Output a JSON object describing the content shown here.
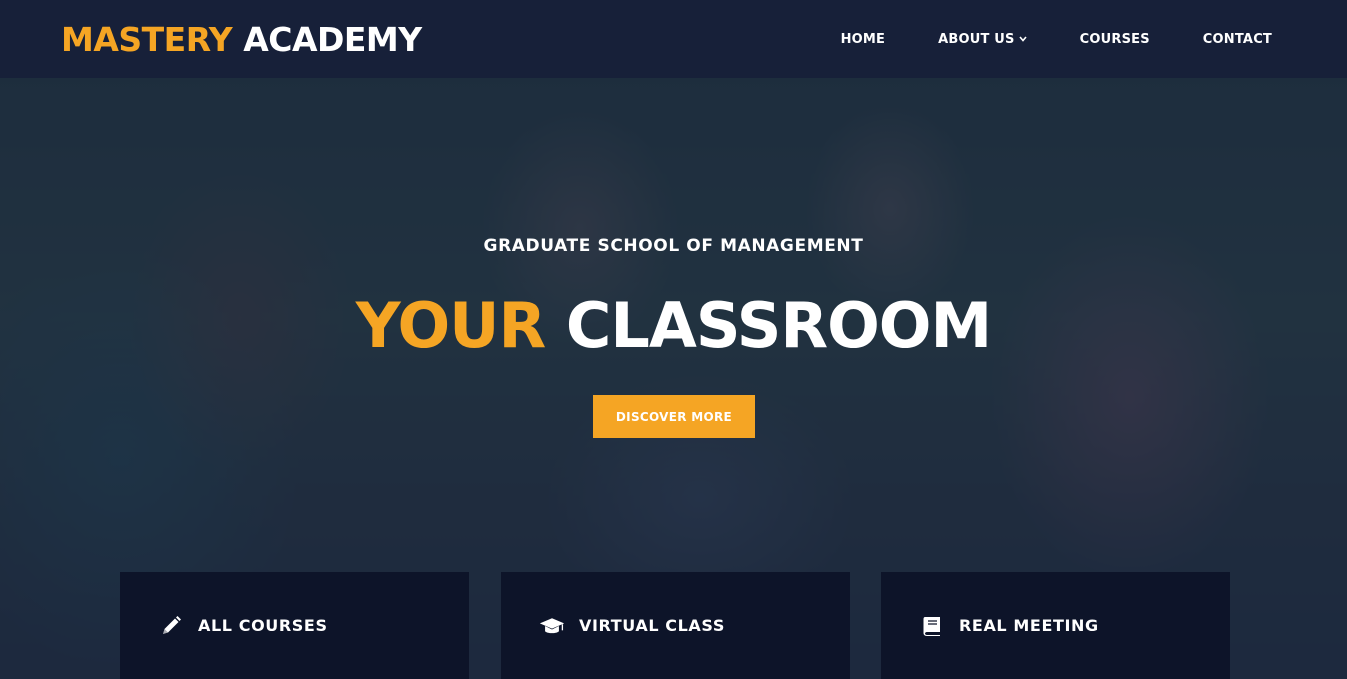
{
  "brand": {
    "name_accent": "MASTERY",
    "name_rest": "ACADEMY"
  },
  "nav": {
    "items": [
      {
        "label": "HOME"
      },
      {
        "label": "ABOUT US",
        "has_dropdown": true
      },
      {
        "label": "COURSES"
      },
      {
        "label": "CONTACT"
      }
    ]
  },
  "hero": {
    "subtitle": "GRADUATE SCHOOL OF MANAGEMENT",
    "headline_accent": "YOUR",
    "headline_rest": "CLASSROOM",
    "cta_label": "DISCOVER MORE"
  },
  "features": [
    {
      "label": "ALL COURSES",
      "icon": "pencil-icon"
    },
    {
      "label": "VIRTUAL CLASS",
      "icon": "graduation-cap-icon"
    },
    {
      "label": "REAL MEETING",
      "icon": "book-icon"
    }
  ],
  "colors": {
    "accent": "#f5a524",
    "navbar": "#172039",
    "card": "#0d1429",
    "text": "#ffffff"
  }
}
